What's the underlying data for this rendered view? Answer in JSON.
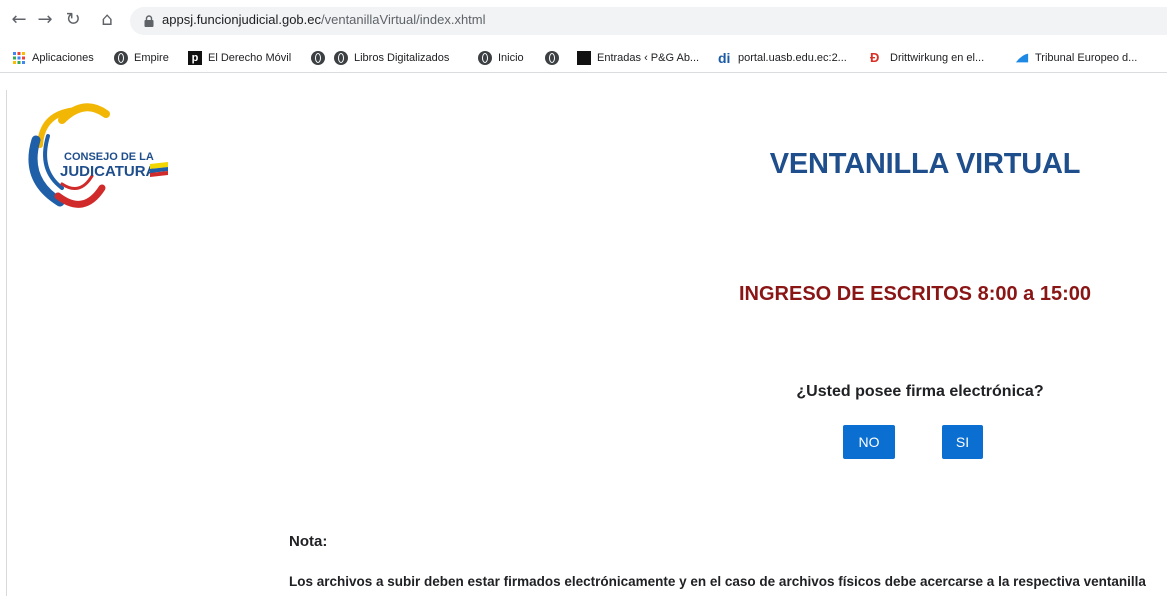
{
  "browser": {
    "url_domain": "appsj.funcionjudicial.gob.ec",
    "url_path": "/ventanillaVirtual/index.xhtml",
    "bookmarks": [
      {
        "label": "Aplicaciones",
        "icon": "apps-grid-icon"
      },
      {
        "label": "Empire",
        "icon": "globe-icon"
      },
      {
        "label": "El Derecho Móvil",
        "icon": "p-icon"
      },
      {
        "label": "",
        "icon": "globe-icon"
      },
      {
        "label": "Libros Digitalizados",
        "icon": "globe-icon"
      },
      {
        "label": "Inicio",
        "icon": "globe-icon"
      },
      {
        "label": "",
        "icon": "globe-icon"
      },
      {
        "label": "Entradas ‹ P&G Ab...",
        "icon": "black-square-icon"
      },
      {
        "label": "portal.uasb.edu.ec:2...",
        "icon": "di-icon"
      },
      {
        "label": "Drittwirkung en el...",
        "icon": "d-icon"
      },
      {
        "label": "Tribunal Europeo d...",
        "icon": "blue-flag-icon"
      }
    ]
  },
  "logo": {
    "line1": "CONSEJO DE LA",
    "line2": "JUDICATURA"
  },
  "page": {
    "title": "VENTANILLA VIRTUAL",
    "subtitle": "INGRESO DE ESCRITOS 8:00 a 15:00",
    "question": "¿Usted posee firma electrónica?",
    "no_label": "NO",
    "si_label": "SI",
    "nota_label": "Nota:",
    "nota_text": "Los archivos a subir deben estar firmados electrónicamente y en el caso de archivos físicos debe acercarse a la respectiva ventanilla"
  },
  "colors": {
    "title": "#1f4e8c",
    "subtitle": "#8a1515",
    "button": "#0a6fd1"
  }
}
